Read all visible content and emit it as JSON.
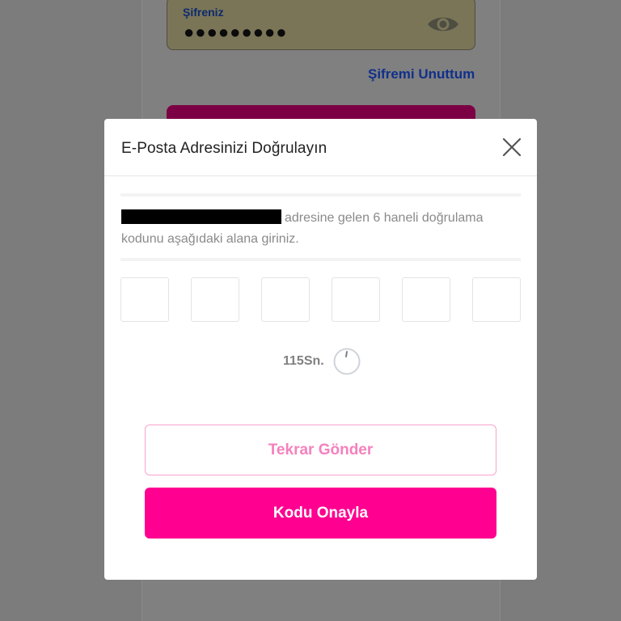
{
  "background": {
    "password_label": "Şifreniz",
    "password_value": "●●●●●●●●●",
    "forgot_password_link": "Şifremi Unuttum"
  },
  "modal": {
    "title": "E-Posta Adresinizi Doğrulayın",
    "message_suffix": "adresine gelen 6 haneli doğrulama kodunu aşağıdaki alana giriniz.",
    "otp_length": 6,
    "otp_values": [
      "",
      "",
      "",
      "",
      "",
      ""
    ],
    "timer_text": "115Sn.",
    "resend_label": "Tekrar Gönder",
    "confirm_label": "Kodu Onayla"
  },
  "icons": {
    "eye": "eye-icon",
    "close": "close-icon",
    "timer": "timer-icon"
  },
  "colors": {
    "primary": "#ff0090",
    "primary_light": "#f581bd",
    "link": "#10308a",
    "overlay": "#7c7c7c"
  }
}
